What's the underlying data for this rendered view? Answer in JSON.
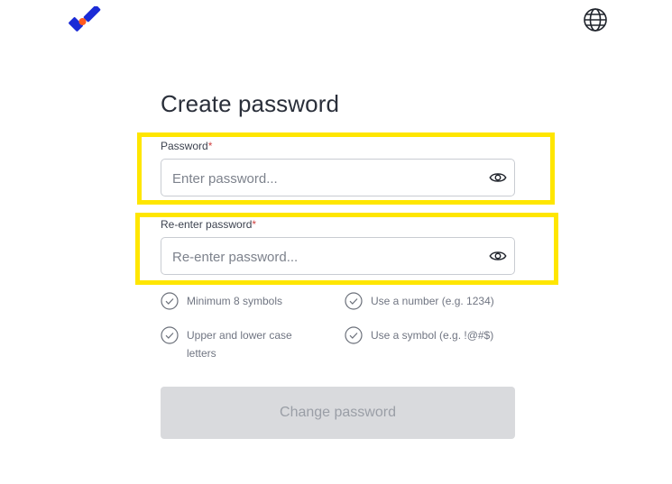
{
  "brand": {
    "logo_icon": "brand-logo-icon",
    "colors": [
      "#1b2bd6",
      "#ff5a1f"
    ]
  },
  "header": {
    "language_icon": "globe-icon"
  },
  "form": {
    "title": "Create password",
    "password": {
      "label": "Password",
      "required_mark": "*",
      "placeholder": "Enter password...",
      "value": ""
    },
    "confirm": {
      "label": "Re-enter password",
      "required_mark": "*",
      "placeholder": "Re-enter password...",
      "value": ""
    },
    "requirements": [
      {
        "text": "Minimum 8 symbols",
        "icon": "check-circle-icon"
      },
      {
        "text": "Use a number (e.g. 1234)",
        "icon": "check-circle-icon"
      },
      {
        "text": "Upper and lower case letters",
        "icon": "check-circle-icon"
      },
      {
        "text": "Use a symbol (e.g. !@#$)",
        "icon": "check-circle-icon"
      }
    ],
    "submit_label": "Change password"
  },
  "colors": {
    "highlight": "#ffe600",
    "button_disabled_bg": "#d9dadd",
    "required": "#d14343"
  }
}
